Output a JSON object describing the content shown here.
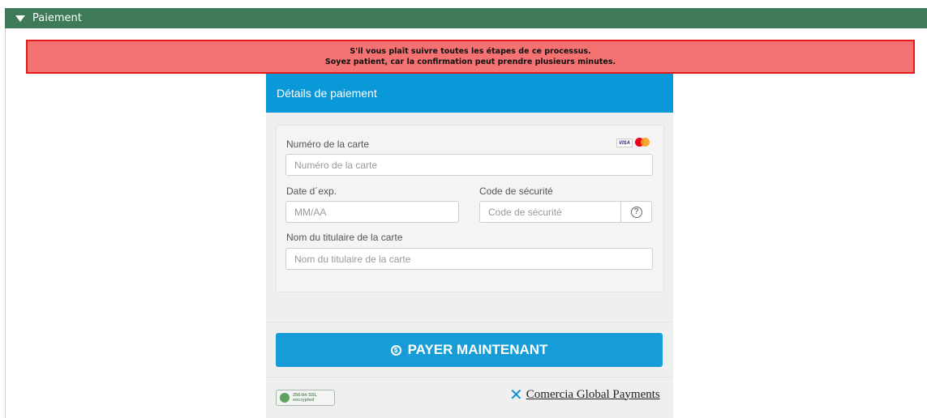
{
  "section": {
    "title": "Paiement"
  },
  "alert": {
    "line1": "S'il vous plaît suivre toutes les étapes de ce processus.",
    "line2": "Soyez patient, car la confirmation peut prendre plusieurs minutes."
  },
  "payment": {
    "header": "Détails de paiement",
    "card_number": {
      "label": "Numéro de la carte",
      "placeholder": "Numéro de la carte"
    },
    "expiry": {
      "label": "Date d´exp.",
      "placeholder": "MM/AA"
    },
    "cvv": {
      "label": "Code de sécurité",
      "placeholder": "Code de sécurité",
      "help": "?"
    },
    "holder": {
      "label": "Nom du titulaire de la carte",
      "placeholder": "Nom du titulaire de la carte"
    },
    "card_logos": {
      "visa": "VISA"
    },
    "pay_button": "PAYER MAINTENANT"
  },
  "footer": {
    "ssl_line1": "256-bit SSL",
    "ssl_line2": "encrypted",
    "brand": "Comercia Global Payments"
  },
  "colors": {
    "header_green": "#3e7a58",
    "alert_bg": "#f47272",
    "alert_border": "#e41b1b",
    "panel_blue": "#0a99d8",
    "button_blue": "#169cd6"
  }
}
